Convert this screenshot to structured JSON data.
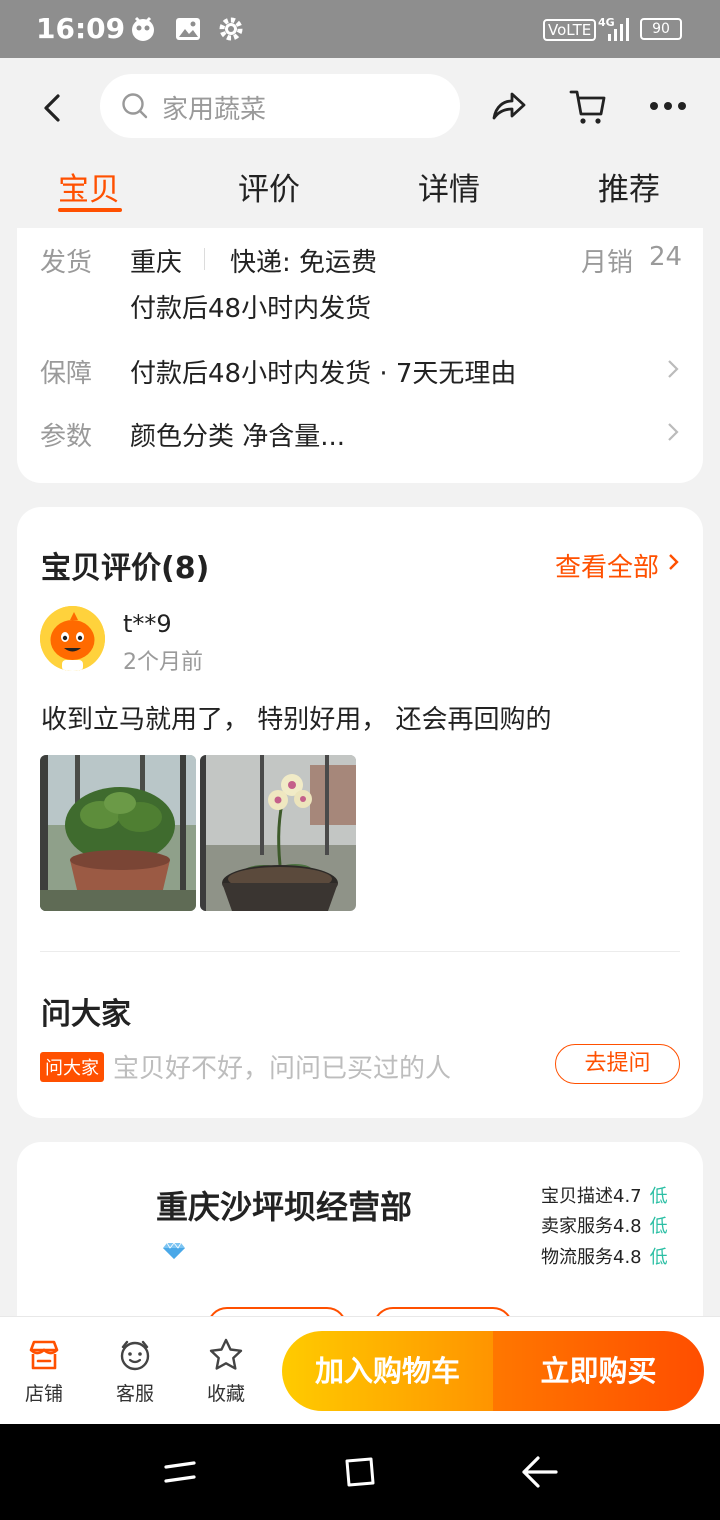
{
  "status_bar": {
    "time": "16:09",
    "volte": "VoLTE",
    "network": "4G",
    "battery": "90"
  },
  "header": {
    "search_placeholder": "家用蔬菜",
    "icons": [
      "back-icon",
      "search-icon",
      "share-icon",
      "cart-icon",
      "more-icon"
    ]
  },
  "tabs": [
    {
      "label": "宝贝",
      "active": true
    },
    {
      "label": "评价",
      "active": false
    },
    {
      "label": "详情",
      "active": false
    },
    {
      "label": "推荐",
      "active": false
    }
  ],
  "delivery": {
    "ship_label": "发货",
    "origin": "重庆",
    "express": "快递: 免运费",
    "monthly_sales_label": "月销",
    "monthly_sales": "24",
    "ship_time": "付款后48小时内发货",
    "guarantee_label": "保障",
    "guarantee_text": "付款后48小时内发货 · 7天无理由",
    "params_label": "参数",
    "params_text": "颜色分类 净含量..."
  },
  "reviews": {
    "title": "宝贝评价(8)",
    "view_all": "查看全部",
    "user": "t**9",
    "time_ago": "2个月前",
    "text": "收到立马就用了， 特别好用， 还会再回购的",
    "photos": [
      "plant-photo",
      "orchid-photo"
    ]
  },
  "ask": {
    "title": "问大家",
    "tag": "问大家",
    "placeholder": "宝贝好不好，问问已买过的人",
    "button": "去提问"
  },
  "shop": {
    "name": "重庆沙坪坝经营部",
    "ratings": [
      {
        "label": "宝贝描述",
        "score": "4.7",
        "level": "低"
      },
      {
        "label": "卖家服务",
        "score": "4.8",
        "level": "低"
      },
      {
        "label": "物流服务",
        "score": "4.8",
        "level": "低"
      }
    ]
  },
  "bottom_bar": {
    "store": "店铺",
    "service": "客服",
    "favorite": "收藏",
    "add_to_cart": "加入购物车",
    "buy_now": "立即购买"
  },
  "colors": {
    "accent": "#ff5000",
    "good_level": "#2bbfa4",
    "cart_gradient": [
      "#ffcb00",
      "#ff9400"
    ],
    "buy_gradient": [
      "#ff7700",
      "#ff4e00"
    ]
  }
}
